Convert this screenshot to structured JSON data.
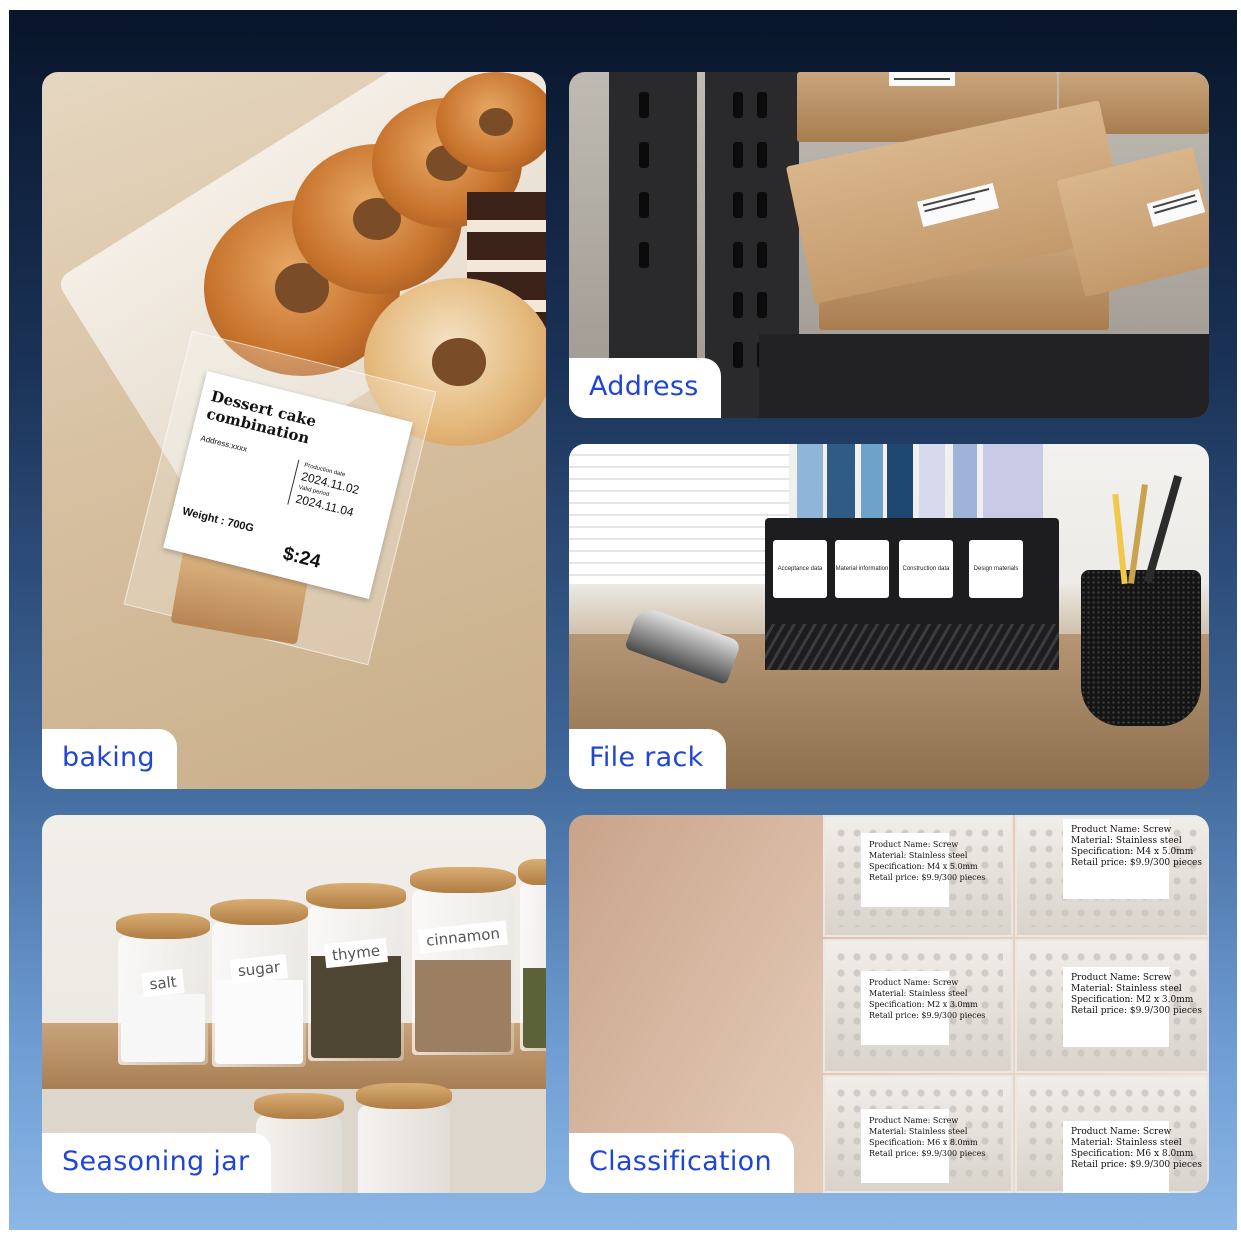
{
  "tiles": {
    "baking": {
      "label": "baking",
      "card": {
        "title": "Dessert cake combination",
        "address": "Address:xxxx",
        "weight": "Weight : 700G",
        "production_label": "Production date",
        "production_date": "2024.11.02",
        "valid_label": "Valid period",
        "valid_date": "2024.11.04",
        "price": "$:24"
      }
    },
    "address": {
      "label": "Address"
    },
    "file_rack": {
      "label": "File rack",
      "file_labels": [
        "Acceptance data",
        "Material information",
        "Construction data",
        "Design materials"
      ]
    },
    "seasoning": {
      "label": "Seasoning jar",
      "jar_labels": [
        "salt",
        "sugar",
        "thyme",
        "cinnamon"
      ]
    },
    "classification": {
      "label": "Classification",
      "product_labels": [
        {
          "name": "Product Name: Screw",
          "material": "Material: Stainless steel",
          "spec": "Specification: M4 x 5.0mm",
          "price": "Retail price: $9.9/300 pieces"
        },
        {
          "name": "Product Name: Screw",
          "material": "Material: Stainless steel",
          "spec": "Specification: M4 x 5.0mm",
          "price": "Retail price: $9.9/300 pieces"
        },
        {
          "name": "Product Name: Screw",
          "material": "Material: Stainless steel",
          "spec": "Specification: M2 x 3.0mm",
          "price": "Retail price: $9.9/300 pieces"
        },
        {
          "name": "Product Name: Screw",
          "material": "Material: Stainless steel",
          "spec": "Specification: M2 x 3.0mm",
          "price": "Retail price: $9.9/300 pieces"
        },
        {
          "name": "Product Name: Screw",
          "material": "Material: Stainless steel",
          "spec": "Specification: M6 x 8.0mm",
          "price": "Retail price: $9.9/300 pieces"
        },
        {
          "name": "Product Name: Screw",
          "material": "Material: Stainless steel",
          "spec": "Specification: M6 x 8.0mm",
          "price": "Retail price: $9.9/300 pieces"
        }
      ]
    }
  },
  "colors": {
    "label_text": "#1f45d8",
    "label_bg": "#ffffff",
    "background_top": "#08152a",
    "background_bottom": "#8cb7e6"
  }
}
